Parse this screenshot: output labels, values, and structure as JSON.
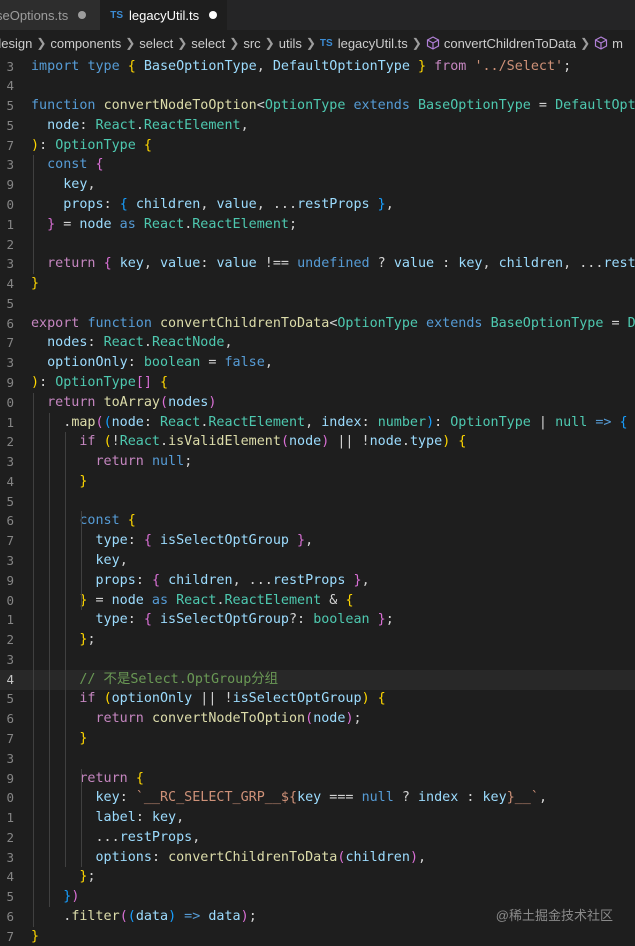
{
  "tabs": [
    {
      "label": "seOptions.ts",
      "modified": true,
      "active": false
    },
    {
      "label": "legacyUtil.ts",
      "modified": true,
      "active": true
    }
  ],
  "tab_badge": "TS",
  "breadcrumb": [
    "design",
    "components",
    "select",
    "select",
    "src",
    "utils",
    "legacyUtil.ts",
    "convertChildrenToData",
    "m"
  ],
  "watermark": "@稀土掘金技术社区",
  "line_numbers": [
    "3",
    "4",
    "5",
    "5",
    "7",
    "3",
    "9",
    "0",
    "1",
    "2",
    "3",
    "4",
    "5",
    "6",
    "7",
    "3",
    "9",
    "0",
    "1",
    "2",
    "3",
    "4",
    "5",
    "6",
    "7",
    "3",
    "9",
    "0",
    "1",
    "2",
    "3",
    "4",
    "5",
    "6",
    "7",
    "3",
    "9",
    "0",
    "1",
    "2",
    "3",
    "4",
    "5",
    "6",
    "7",
    "3"
  ],
  "colors": {
    "background": "#1e1e1e",
    "keyword": "#569cd6",
    "control": "#c586c0",
    "function": "#dcdcaa",
    "type": "#4ec9b0",
    "variable": "#9cdcfe",
    "string": "#ce9178",
    "comment": "#6a9955"
  },
  "code": [
    [
      [
        "k",
        "import "
      ],
      [
        "k",
        "type "
      ],
      [
        "bk1",
        "{ "
      ],
      [
        "v",
        "BaseOptionType"
      ],
      [
        "p",
        ", "
      ],
      [
        "v",
        "DefaultOptionType"
      ],
      [
        "bk1",
        " }"
      ],
      [
        "c",
        " from "
      ],
      [
        "s",
        "'../Select'"
      ],
      [
        "p",
        ";"
      ]
    ],
    [],
    [
      [
        "k",
        "function "
      ],
      [
        "f",
        "convertNodeToOption"
      ],
      [
        "p",
        "<"
      ],
      [
        "t",
        "OptionType"
      ],
      [
        "k",
        " extends "
      ],
      [
        "t",
        "BaseOptionType"
      ],
      [
        "p",
        " = "
      ],
      [
        "t",
        "DefaultOpti"
      ]
    ],
    [
      [
        "p",
        "  "
      ],
      [
        "v",
        "node"
      ],
      [
        "p",
        ": "
      ],
      [
        "t",
        "React"
      ],
      [
        "p",
        "."
      ],
      [
        "t",
        "ReactElement"
      ],
      [
        "p",
        ","
      ]
    ],
    [
      [
        "bk1",
        ")"
      ],
      [
        "p",
        ": "
      ],
      [
        "t",
        "OptionType"
      ],
      [
        "bk1",
        " {"
      ]
    ],
    [
      [
        "p",
        "  "
      ],
      [
        "k",
        "const "
      ],
      [
        "bk2",
        "{"
      ]
    ],
    [
      [
        "p",
        "    "
      ],
      [
        "v",
        "key"
      ],
      [
        "p",
        ","
      ]
    ],
    [
      [
        "p",
        "    "
      ],
      [
        "v",
        "props"
      ],
      [
        "p",
        ": "
      ],
      [
        "bk3",
        "{ "
      ],
      [
        "v",
        "children"
      ],
      [
        "p",
        ", "
      ],
      [
        "v",
        "value"
      ],
      [
        "p",
        ", ..."
      ],
      [
        "v",
        "restProps"
      ],
      [
        "bk3",
        " }"
      ],
      [
        "p",
        ","
      ]
    ],
    [
      [
        "p",
        "  "
      ],
      [
        "bk2",
        "}"
      ],
      [
        "p",
        " = "
      ],
      [
        "v",
        "node"
      ],
      [
        "k",
        " as "
      ],
      [
        "t",
        "React"
      ],
      [
        "p",
        "."
      ],
      [
        "t",
        "ReactElement"
      ],
      [
        "p",
        ";"
      ]
    ],
    [],
    [
      [
        "p",
        "  "
      ],
      [
        "c",
        "return "
      ],
      [
        "bk2",
        "{ "
      ],
      [
        "v",
        "key"
      ],
      [
        "p",
        ", "
      ],
      [
        "v",
        "value"
      ],
      [
        "p",
        ": "
      ],
      [
        "v",
        "value"
      ],
      [
        "p",
        " !== "
      ],
      [
        "k",
        "undefined"
      ],
      [
        "p",
        " ? "
      ],
      [
        "v",
        "value"
      ],
      [
        "p",
        " : "
      ],
      [
        "v",
        "key"
      ],
      [
        "p",
        ", "
      ],
      [
        "v",
        "children"
      ],
      [
        "p",
        ", ..."
      ],
      [
        "v",
        "restP"
      ]
    ],
    [
      [
        "bk1",
        "}"
      ]
    ],
    [],
    [
      [
        "c",
        "export "
      ],
      [
        "k",
        "function "
      ],
      [
        "f",
        "convertChildrenToData"
      ],
      [
        "p",
        "<"
      ],
      [
        "t",
        "OptionType"
      ],
      [
        "k",
        " extends "
      ],
      [
        "t",
        "BaseOptionType"
      ],
      [
        "p",
        " = "
      ],
      [
        "t",
        "De"
      ]
    ],
    [
      [
        "p",
        "  "
      ],
      [
        "v",
        "nodes"
      ],
      [
        "p",
        ": "
      ],
      [
        "t",
        "React"
      ],
      [
        "p",
        "."
      ],
      [
        "t",
        "ReactNode"
      ],
      [
        "p",
        ","
      ]
    ],
    [
      [
        "p",
        "  "
      ],
      [
        "v",
        "optionOnly"
      ],
      [
        "p",
        ": "
      ],
      [
        "t",
        "boolean"
      ],
      [
        "p",
        " = "
      ],
      [
        "k",
        "false"
      ],
      [
        "p",
        ","
      ]
    ],
    [
      [
        "bk1",
        ")"
      ],
      [
        "p",
        ": "
      ],
      [
        "t",
        "OptionType"
      ],
      [
        "bk2",
        "[]"
      ],
      [
        "bk1",
        " {"
      ]
    ],
    [
      [
        "p",
        "  "
      ],
      [
        "c",
        "return "
      ],
      [
        "f",
        "toArray"
      ],
      [
        "bk2",
        "("
      ],
      [
        "v",
        "nodes"
      ],
      [
        "bk2",
        ")"
      ]
    ],
    [
      [
        "p",
        "    ."
      ],
      [
        "f",
        "map"
      ],
      [
        "bk2",
        "("
      ],
      [
        "bk3",
        "("
      ],
      [
        "v",
        "node"
      ],
      [
        "p",
        ": "
      ],
      [
        "t",
        "React"
      ],
      [
        "p",
        "."
      ],
      [
        "t",
        "ReactElement"
      ],
      [
        "p",
        ", "
      ],
      [
        "v",
        "index"
      ],
      [
        "p",
        ": "
      ],
      [
        "t",
        "number"
      ],
      [
        "bk3",
        ")"
      ],
      [
        "p",
        ": "
      ],
      [
        "t",
        "OptionType"
      ],
      [
        "p",
        " | "
      ],
      [
        "t",
        "null"
      ],
      [
        "k",
        " =>"
      ],
      [
        "bk3",
        " {"
      ]
    ],
    [
      [
        "p",
        "      "
      ],
      [
        "c",
        "if "
      ],
      [
        "bk1",
        "("
      ],
      [
        "p",
        "!"
      ],
      [
        "t",
        "React"
      ],
      [
        "p",
        "."
      ],
      [
        "f",
        "isValidElement"
      ],
      [
        "bk2",
        "("
      ],
      [
        "v",
        "node"
      ],
      [
        "bk2",
        ")"
      ],
      [
        "p",
        " || !"
      ],
      [
        "v",
        "node"
      ],
      [
        "p",
        "."
      ],
      [
        "v",
        "type"
      ],
      [
        "bk1",
        ")"
      ],
      [
        "bk1",
        " {"
      ]
    ],
    [
      [
        "p",
        "        "
      ],
      [
        "c",
        "return "
      ],
      [
        "k",
        "null"
      ],
      [
        "p",
        ";"
      ]
    ],
    [
      [
        "p",
        "      "
      ],
      [
        "bk1",
        "}"
      ]
    ],
    [],
    [
      [
        "p",
        "      "
      ],
      [
        "k",
        "const "
      ],
      [
        "bk1",
        "{"
      ]
    ],
    [
      [
        "p",
        "        "
      ],
      [
        "v",
        "type"
      ],
      [
        "p",
        ": "
      ],
      [
        "bk2",
        "{ "
      ],
      [
        "v",
        "isSelectOptGroup"
      ],
      [
        "bk2",
        " }"
      ],
      [
        "p",
        ","
      ]
    ],
    [
      [
        "p",
        "        "
      ],
      [
        "v",
        "key"
      ],
      [
        "p",
        ","
      ]
    ],
    [
      [
        "p",
        "        "
      ],
      [
        "v",
        "props"
      ],
      [
        "p",
        ": "
      ],
      [
        "bk2",
        "{ "
      ],
      [
        "v",
        "children"
      ],
      [
        "p",
        ", ..."
      ],
      [
        "v",
        "restProps"
      ],
      [
        "bk2",
        " }"
      ],
      [
        "p",
        ","
      ]
    ],
    [
      [
        "p",
        "      "
      ],
      [
        "bk1",
        "}"
      ],
      [
        "p",
        " = "
      ],
      [
        "v",
        "node"
      ],
      [
        "k",
        " as "
      ],
      [
        "t",
        "React"
      ],
      [
        "p",
        "."
      ],
      [
        "t",
        "ReactElement"
      ],
      [
        "p",
        " & "
      ],
      [
        "bk1",
        "{"
      ]
    ],
    [
      [
        "p",
        "        "
      ],
      [
        "v",
        "type"
      ],
      [
        "p",
        ": "
      ],
      [
        "bk2",
        "{ "
      ],
      [
        "v",
        "isSelectOptGroup"
      ],
      [
        "p",
        "?: "
      ],
      [
        "t",
        "boolean"
      ],
      [
        "bk2",
        " }"
      ],
      [
        "p",
        ";"
      ]
    ],
    [
      [
        "p",
        "      "
      ],
      [
        "bk1",
        "}"
      ],
      [
        "p",
        ";"
      ]
    ],
    [],
    [
      [
        "p",
        "      "
      ],
      [
        "cm",
        "// 不是Select.OptGroup分组"
      ]
    ],
    [
      [
        "p",
        "      "
      ],
      [
        "c",
        "if "
      ],
      [
        "bk1",
        "("
      ],
      [
        "v",
        "optionOnly"
      ],
      [
        "p",
        " || !"
      ],
      [
        "v",
        "isSelectOptGroup"
      ],
      [
        "bk1",
        ")"
      ],
      [
        "bk1",
        " {"
      ]
    ],
    [
      [
        "p",
        "        "
      ],
      [
        "c",
        "return "
      ],
      [
        "f",
        "convertNodeToOption"
      ],
      [
        "bk2",
        "("
      ],
      [
        "v",
        "node"
      ],
      [
        "bk2",
        ")"
      ],
      [
        "p",
        ";"
      ]
    ],
    [
      [
        "p",
        "      "
      ],
      [
        "bk1",
        "}"
      ]
    ],
    [],
    [
      [
        "p",
        "      "
      ],
      [
        "c",
        "return "
      ],
      [
        "bk1",
        "{"
      ]
    ],
    [
      [
        "p",
        "        "
      ],
      [
        "v",
        "key"
      ],
      [
        "p",
        ": "
      ],
      [
        "s",
        "`__RC_SELECT_GRP__${"
      ],
      [
        "v",
        "key"
      ],
      [
        "p",
        " === "
      ],
      [
        "k",
        "null"
      ],
      [
        "p",
        " ? "
      ],
      [
        "v",
        "index"
      ],
      [
        "p",
        " : "
      ],
      [
        "v",
        "key"
      ],
      [
        "s",
        "}__`"
      ],
      [
        "p",
        ","
      ]
    ],
    [
      [
        "p",
        "        "
      ],
      [
        "v",
        "label"
      ],
      [
        "p",
        ": "
      ],
      [
        "v",
        "key"
      ],
      [
        "p",
        ","
      ]
    ],
    [
      [
        "p",
        "        ..."
      ],
      [
        "v",
        "restProps"
      ],
      [
        "p",
        ","
      ]
    ],
    [
      [
        "p",
        "        "
      ],
      [
        "v",
        "options"
      ],
      [
        "p",
        ": "
      ],
      [
        "f",
        "convertChildrenToData"
      ],
      [
        "bk2",
        "("
      ],
      [
        "v",
        "children"
      ],
      [
        "bk2",
        ")"
      ],
      [
        "p",
        ","
      ]
    ],
    [
      [
        "p",
        "      "
      ],
      [
        "bk1",
        "}"
      ],
      [
        "p",
        ";"
      ]
    ],
    [
      [
        "p",
        "    "
      ],
      [
        "bk3",
        "}"
      ],
      [
        "bk2",
        ")"
      ]
    ],
    [
      [
        "p",
        "    ."
      ],
      [
        "f",
        "filter"
      ],
      [
        "bk2",
        "("
      ],
      [
        "bk3",
        "("
      ],
      [
        "v",
        "data"
      ],
      [
        "bk3",
        ")"
      ],
      [
        "k",
        " =>"
      ],
      [
        "v",
        " data"
      ],
      [
        "bk2",
        ")"
      ],
      [
        "p",
        ";"
      ]
    ],
    [
      [
        "bk1",
        "}"
      ]
    ]
  ]
}
